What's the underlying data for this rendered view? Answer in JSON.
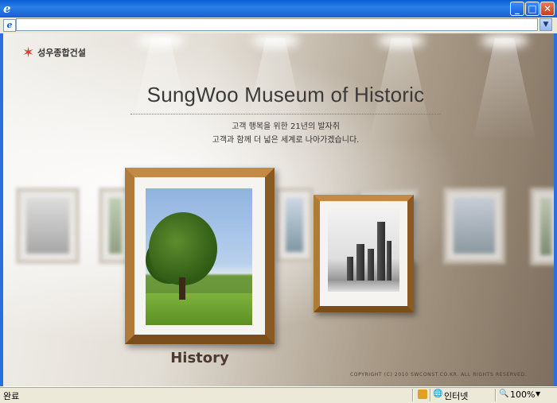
{
  "browser": {
    "status_text": "완료",
    "security_zone": "인터넷",
    "zoom": "100%",
    "icons": {
      "window": "ie-logo-icon",
      "address": "page-icon",
      "minimize": "minimize-icon",
      "maximize": "maximize-icon",
      "close": "close-icon",
      "zone": "globe-icon",
      "zoom": "magnifier-icon"
    }
  },
  "site": {
    "logo_text": "성우종합건설",
    "title": "SungWoo Museum of Historic",
    "subtitle_line1": "고객 행복을 위한 21년의 발자취",
    "subtitle_line2": "고객과 함께 더 넓은 세계로 나아가겠습니다.",
    "frame_label": "History",
    "copyright": "COPYRIGHT (C) 2010 SWCONST.CO.KR. ALL RIGHTS RESERVED.",
    "colors": {
      "frame_gold": "#a06a2c",
      "logo_star": "#d9432b",
      "browser_blue": "#0a5fd6"
    }
  }
}
